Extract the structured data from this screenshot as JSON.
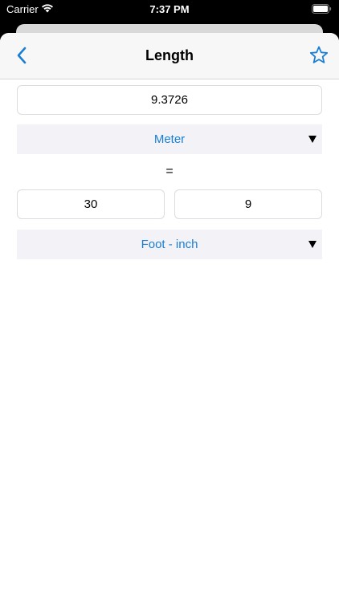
{
  "status_bar": {
    "carrier": "Carrier",
    "time": "7:37 PM"
  },
  "nav": {
    "title": "Length",
    "back_icon": "chevron-left-icon",
    "favorite_icon": "star-outline-icon",
    "accent_color": "#1a7fd4"
  },
  "converter": {
    "input_value": "9.3726",
    "from_unit": "Meter",
    "equals": "=",
    "result_feet": "30",
    "result_inches": "9",
    "to_unit": "Foot - inch"
  }
}
